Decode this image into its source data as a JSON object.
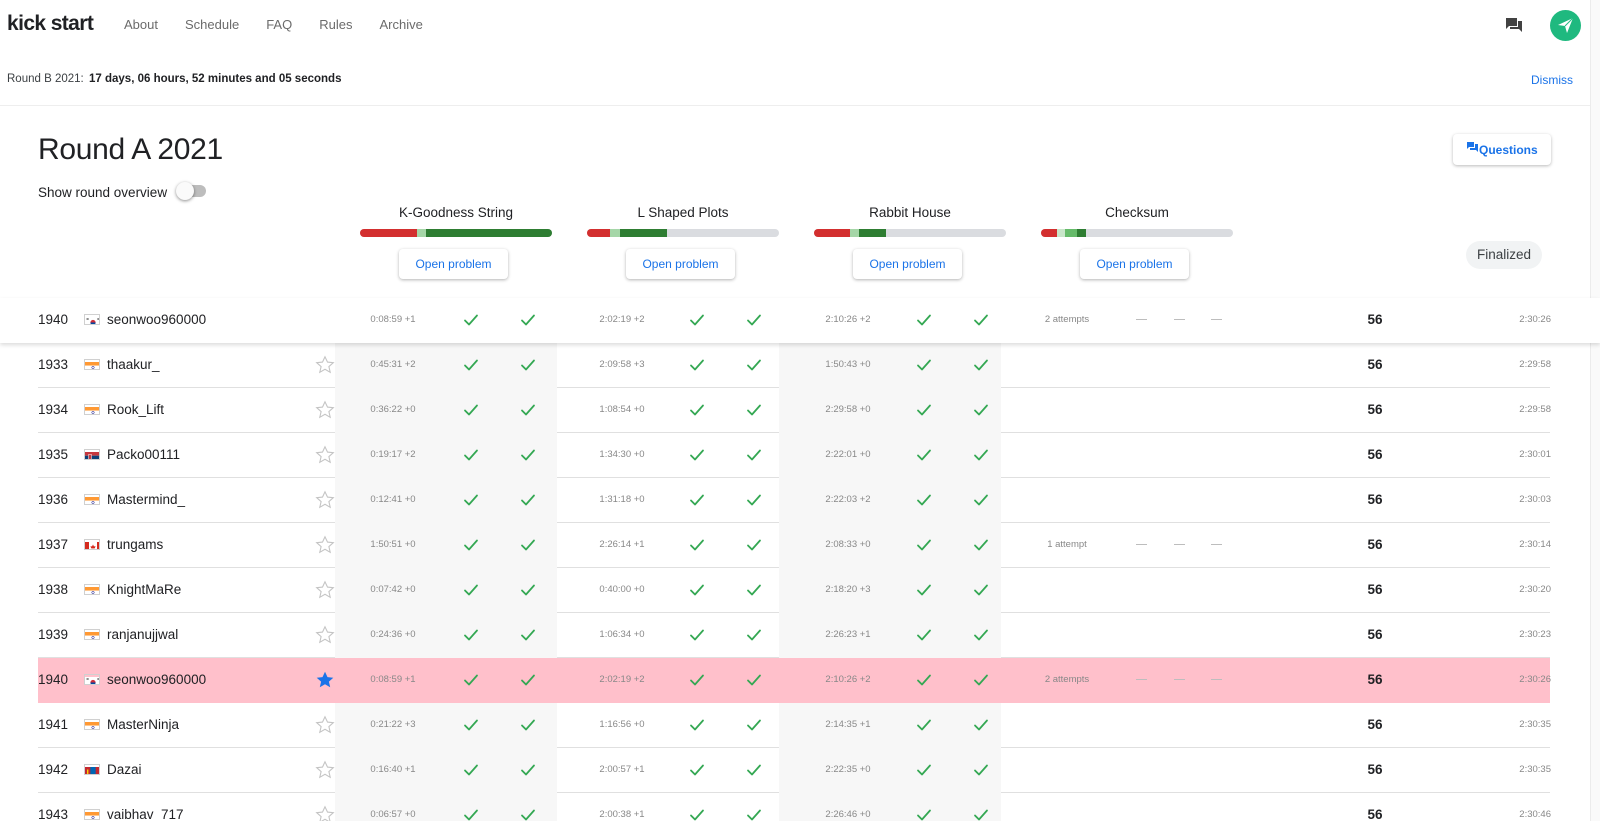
{
  "app": {
    "logo": "kick start",
    "nav": [
      "About",
      "Schedule",
      "FAQ",
      "Rules",
      "Archive"
    ]
  },
  "banner": {
    "label": "Round B 2021:",
    "countdown": "17 days, 06 hours, 52 minutes and 05 seconds",
    "dismiss": "Dismiss"
  },
  "round": {
    "title": "Round A 2021",
    "overview_label": "Show round overview",
    "overview_on": false,
    "questions_label": "Questions",
    "status": "Finalized"
  },
  "problems": [
    {
      "name": "K-Goodness String",
      "open_label": "Open problem"
    },
    {
      "name": "L Shaped Plots",
      "open_label": "Open problem"
    },
    {
      "name": "Rabbit House",
      "open_label": "Open problem"
    },
    {
      "name": "Checksum",
      "open_label": "Open problem"
    }
  ],
  "colors": {
    "accent": "#1a73e8",
    "wrong": "#d32f2f",
    "solved": "#2e7d32",
    "light_solved": "#a5d6a7",
    "mid_solved": "#66bb6a",
    "check": "#34a853",
    "highlight_row": "#ffc0cb",
    "star_active": "#1a73e8"
  },
  "pinned_row": {
    "rank": "1940",
    "country": "kr",
    "user": "seonwoo960000",
    "times": [
      "0:08:59 +1",
      "2:02:19 +2",
      "2:10:26 +2"
    ],
    "attempts": "2 attempts",
    "score": "56",
    "penalty": "2:30:26"
  },
  "rows": [
    {
      "rank": "1933",
      "country": "in",
      "user": "thaakur_",
      "times": [
        "0:45:31 +2",
        "2:09:58 +3",
        "1:50:43 +0"
      ],
      "attempts": "",
      "score": "56",
      "penalty": "2:29:58",
      "starred": false,
      "highlight": false
    },
    {
      "rank": "1934",
      "country": "in",
      "user": "Rook_Lift",
      "times": [
        "0:36:22 +0",
        "1:08:54 +0",
        "2:29:58 +0"
      ],
      "attempts": "",
      "score": "56",
      "penalty": "2:29:58",
      "starred": false,
      "highlight": false
    },
    {
      "rank": "1935",
      "country": "rs",
      "user": "Packo00111",
      "times": [
        "0:19:17 +2",
        "1:34:30 +0",
        "2:22:01 +0"
      ],
      "attempts": "",
      "score": "56",
      "penalty": "2:30:01",
      "starred": false,
      "highlight": false
    },
    {
      "rank": "1936",
      "country": "in",
      "user": "Mastermind_",
      "times": [
        "0:12:41 +0",
        "1:31:18 +0",
        "2:22:03 +2"
      ],
      "attempts": "",
      "score": "56",
      "penalty": "2:30:03",
      "starred": false,
      "highlight": false
    },
    {
      "rank": "1937",
      "country": "ca",
      "user": "trungams",
      "times": [
        "1:50:51 +0",
        "2:26:14 +1",
        "2:08:33 +0"
      ],
      "attempts": "1 attempt",
      "score": "56",
      "penalty": "2:30:14",
      "starred": false,
      "highlight": false
    },
    {
      "rank": "1938",
      "country": "in",
      "user": "KnightMaRe",
      "times": [
        "0:07:42 +0",
        "0:40:00 +0",
        "2:18:20 +3"
      ],
      "attempts": "",
      "score": "56",
      "penalty": "2:30:20",
      "starred": false,
      "highlight": false
    },
    {
      "rank": "1939",
      "country": "in",
      "user": "ranjanujjwal",
      "times": [
        "0:24:36 +0",
        "1:06:34 +0",
        "2:26:23 +1"
      ],
      "attempts": "",
      "score": "56",
      "penalty": "2:30:23",
      "starred": false,
      "highlight": false
    },
    {
      "rank": "1940",
      "country": "kr",
      "user": "seonwoo960000",
      "times": [
        "0:08:59 +1",
        "2:02:19 +2",
        "2:10:26 +2"
      ],
      "attempts": "2 attempts",
      "score": "56",
      "penalty": "2:30:26",
      "starred": true,
      "highlight": true
    },
    {
      "rank": "1941",
      "country": "in",
      "user": "MasterNinja",
      "times": [
        "0:21:22 +3",
        "1:16:56 +0",
        "2:14:35 +1"
      ],
      "attempts": "",
      "score": "56",
      "penalty": "2:30:35",
      "starred": false,
      "highlight": false
    },
    {
      "rank": "1942",
      "country": "mn",
      "user": "Dazai",
      "times": [
        "0:16:40 +1",
        "2:00:57 +1",
        "2:22:35 +0"
      ],
      "attempts": "",
      "score": "56",
      "penalty": "2:30:35",
      "starred": false,
      "highlight": false
    },
    {
      "rank": "1943",
      "country": "in",
      "user": "vaibhav_717",
      "times": [
        "0:06:57 +0",
        "2:00:38 +1",
        "2:26:46 +0"
      ],
      "attempts": "",
      "score": "56",
      "penalty": "2:30:46",
      "starred": false,
      "highlight": false
    }
  ]
}
